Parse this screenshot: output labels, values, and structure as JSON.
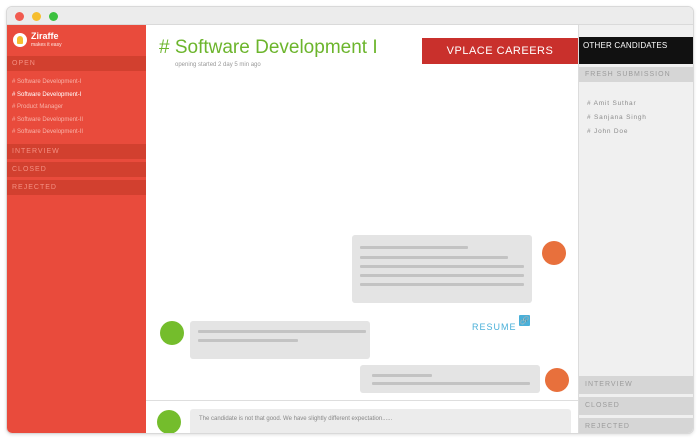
{
  "app": {
    "name": "Ziraffe",
    "tagline": "makes it easy"
  },
  "sidebar": {
    "sections": {
      "open": "OPEN",
      "interview": "INTERVIEW",
      "closed": "CLOSED",
      "rejected": "REJECTED"
    },
    "jobs": [
      {
        "label": "# Software Development-I",
        "active": false
      },
      {
        "label": "# Software Development-I",
        "active": true
      },
      {
        "label": "# Product Manager",
        "active": false
      },
      {
        "label": "# Software Development-II",
        "active": false
      },
      {
        "label": "# Software Development-II",
        "active": false
      }
    ]
  },
  "main": {
    "title": "# Software Development I",
    "subtitle": "opening started 2 day 5 min ago",
    "banner": "VPLACE CAREERS",
    "resume_label": "RESUME",
    "composer_text": "The candidate is not that good. We have slightly different expectation......"
  },
  "right": {
    "title": "OTHER CANDIDATES",
    "fresh_label": "FRESH SUBMISSION",
    "candidates": [
      "# Amit Suthar",
      "# Sanjana Singh",
      "# John Doe"
    ],
    "sections": {
      "interview": "INTERVIEW",
      "closed": "CLOSED",
      "rejected": "REJECTED"
    }
  },
  "colors": {
    "brand_red": "#e94b3c",
    "accent_green": "#6cb52c",
    "banner_red": "#c9302c",
    "link_blue": "#4ab0d9",
    "avatar_orange": "#e8703c",
    "avatar_green": "#74bd2c"
  },
  "icons": {
    "logo": "giraffe-logo-icon",
    "attachment": "link-icon"
  }
}
